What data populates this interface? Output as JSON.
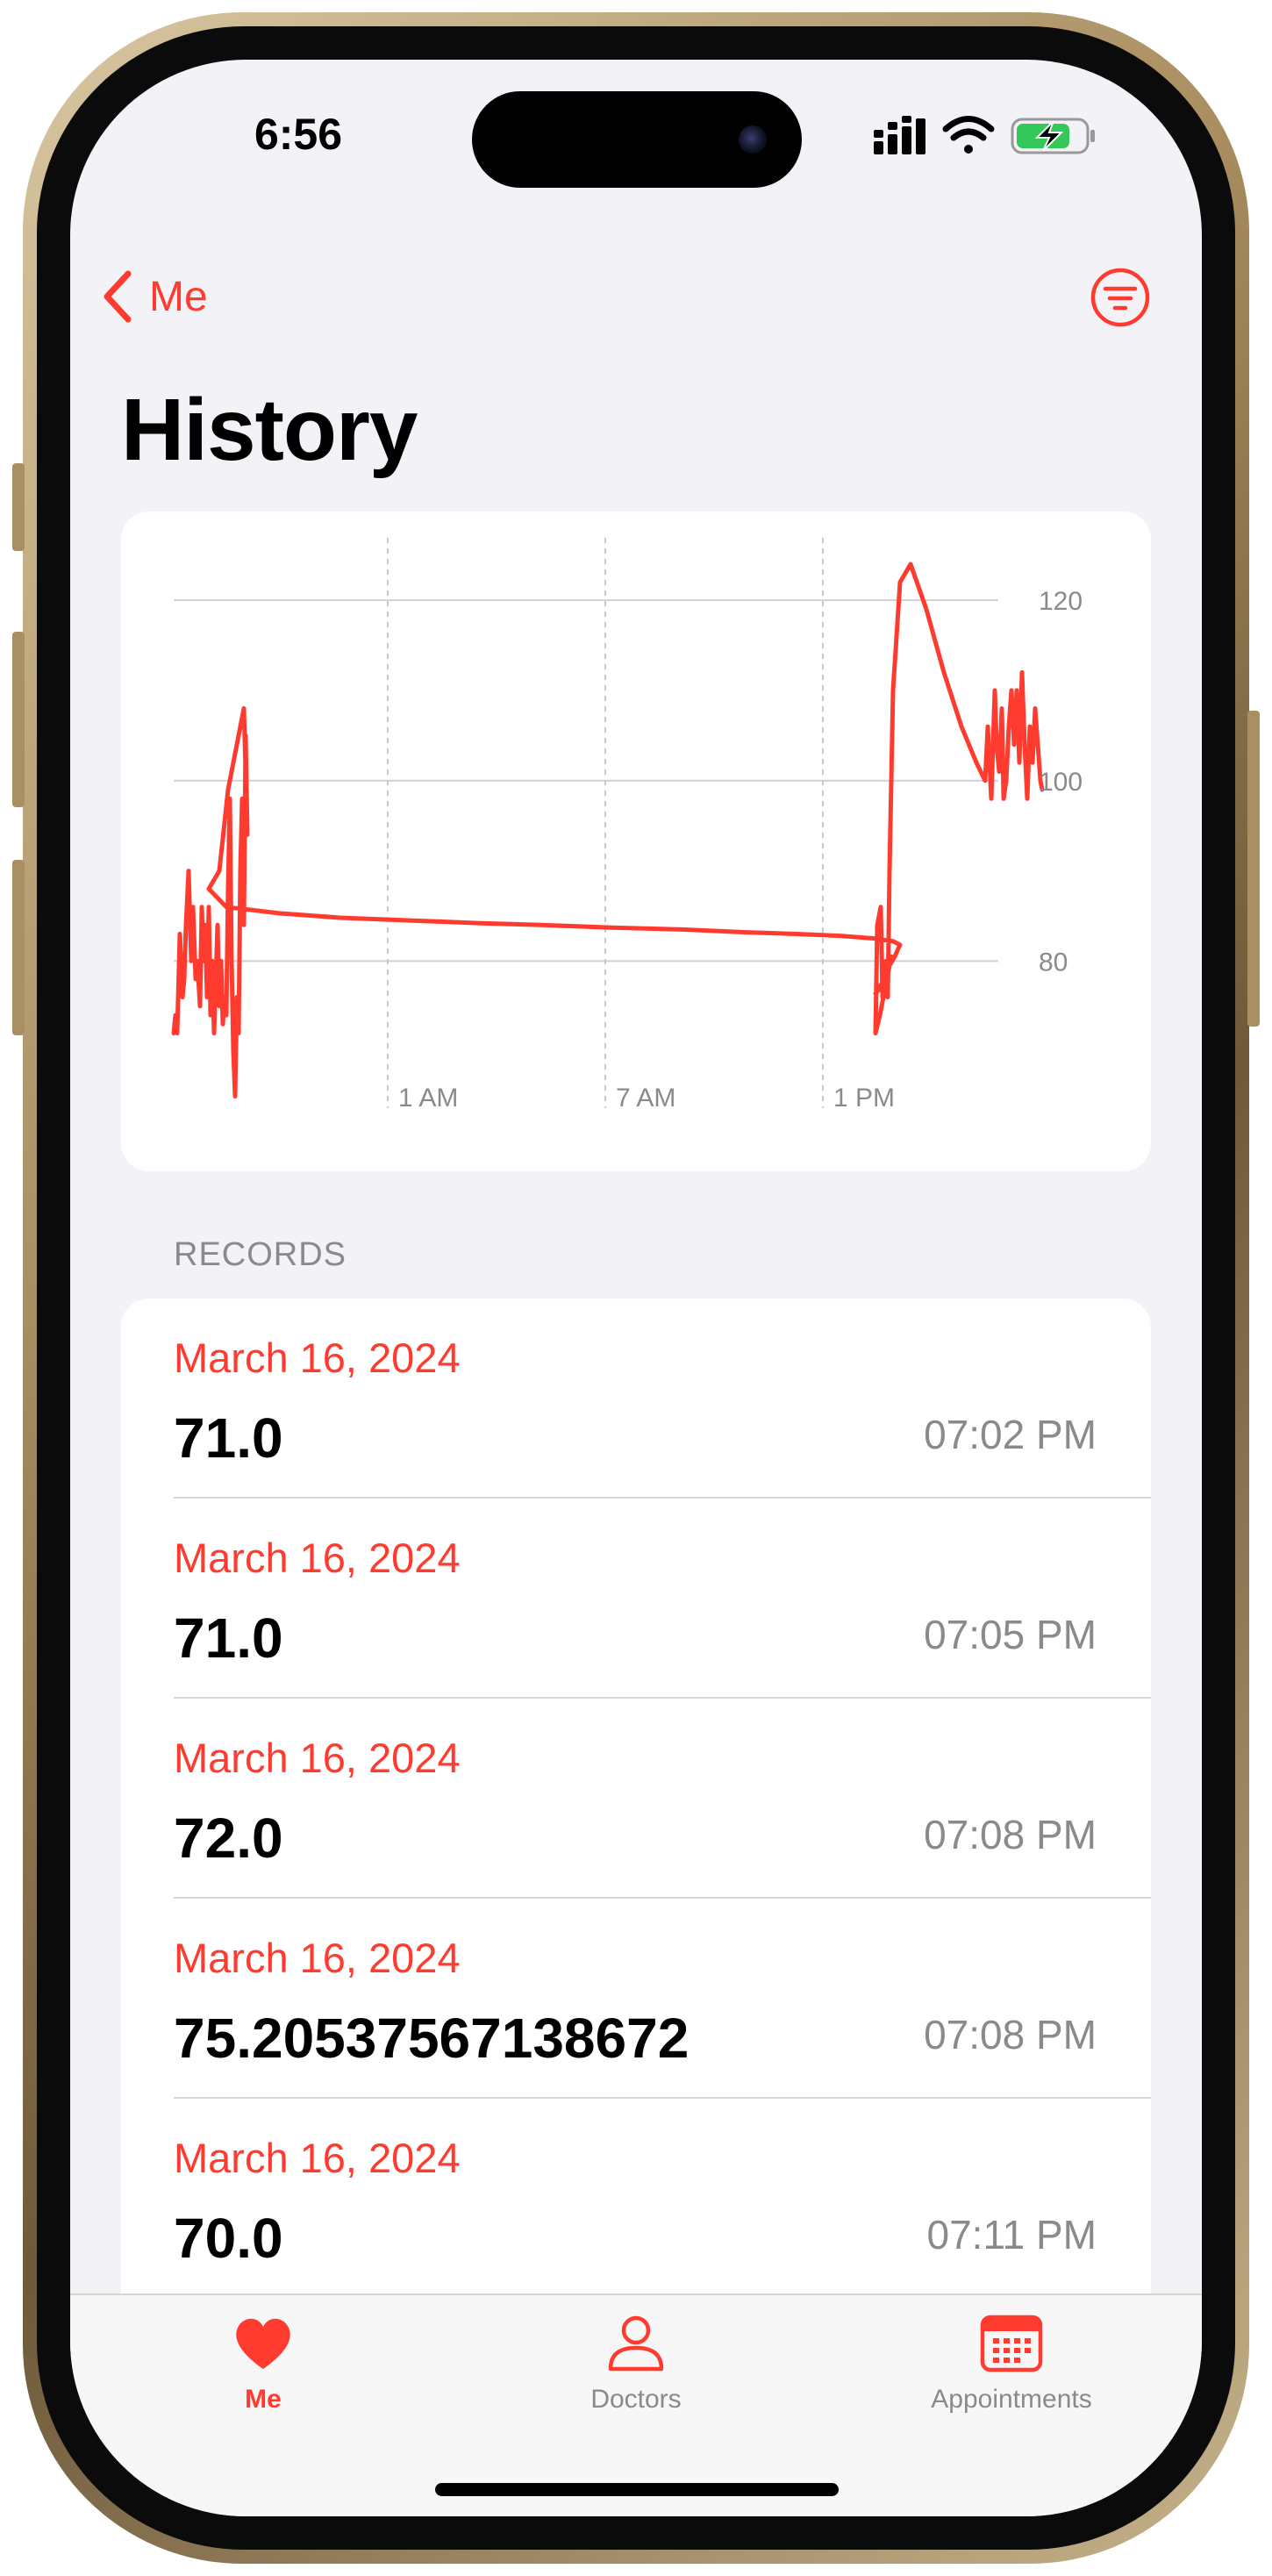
{
  "status_bar": {
    "time": "6:56",
    "battery": "charging"
  },
  "nav": {
    "back_label": "Me",
    "filter_icon": "filter-circle-icon"
  },
  "title": "History",
  "colors": {
    "accent": "#ff3b30",
    "secondary_text": "#8a8a8e",
    "background": "#f2f2f7"
  },
  "chart_data": {
    "type": "line",
    "title": "",
    "xlabel": "",
    "ylabel": "",
    "x_tick_labels": [
      "1 AM",
      "7 AM",
      "1 PM"
    ],
    "y_tick_labels": [
      "120",
      "100",
      "80"
    ],
    "ylim": [
      60,
      124
    ],
    "grid": true,
    "legend": "none",
    "color": "#ff3b30",
    "series": [
      {
        "values": [
          72,
          74,
          72,
          83,
          76,
          78,
          84,
          90,
          80,
          86,
          78,
          80,
          75,
          86,
          80,
          84,
          76,
          86,
          74,
          80,
          72,
          78,
          84,
          75,
          80,
          73,
          76,
          74,
          88,
          98,
          80,
          70,
          65,
          76,
          72,
          90,
          98,
          84,
          105,
          94,
          108,
          99,
          90,
          88,
          86,
          85.3,
          84.8,
          84.5,
          84.2,
          84.0,
          83.7,
          83.5,
          83.2,
          83.0,
          82.8,
          82.5,
          82.2,
          81.8,
          81.4,
          80.5,
          79.5,
          77.5,
          76.4,
          77.5,
          80.5,
          74,
          72,
          84,
          86,
          76,
          80,
          76,
          90,
          110,
          122,
          124,
          119,
          112,
          106,
          102,
          100,
          106,
          98,
          110,
          104,
          101,
          108,
          98,
          100,
          106,
          110,
          104,
          110,
          102,
          112,
          104,
          98,
          106,
          102,
          108,
          104,
          100,
          99
        ]
      }
    ]
  },
  "records": {
    "header": "RECORDS",
    "items": [
      {
        "date": "March 16, 2024",
        "value": "71.0",
        "time": "07:02 PM"
      },
      {
        "date": "March 16, 2024",
        "value": "71.0",
        "time": "07:05 PM"
      },
      {
        "date": "March 16, 2024",
        "value": "72.0",
        "time": "07:08 PM"
      },
      {
        "date": "March 16, 2024",
        "value": "75.20537567138672",
        "time": "07:08 PM"
      },
      {
        "date": "March 16, 2024",
        "value": "70.0",
        "time": "07:11 PM"
      }
    ]
  },
  "tabs": [
    {
      "label": "Me",
      "icon": "heart-fill-icon",
      "selected": true
    },
    {
      "label": "Doctors",
      "icon": "person-icon",
      "selected": false
    },
    {
      "label": "Appointments",
      "icon": "calendar-icon",
      "selected": false
    }
  ]
}
